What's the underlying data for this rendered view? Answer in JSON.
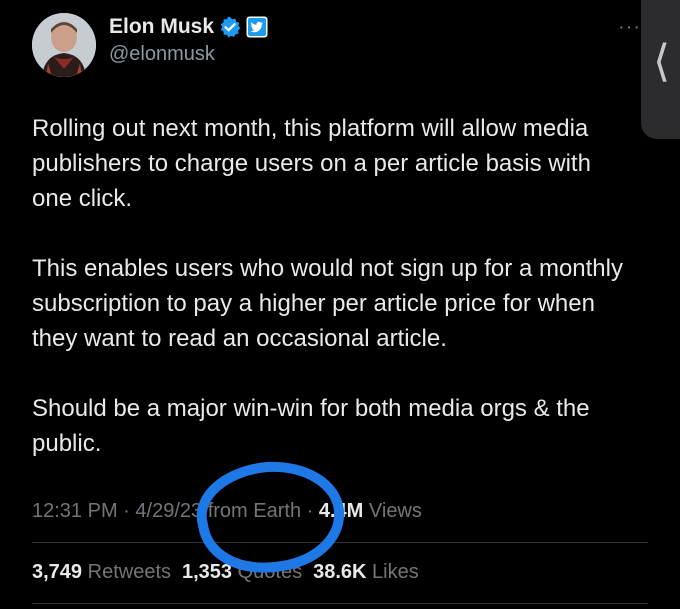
{
  "author": {
    "display_name": "Elon Musk",
    "handle": "@elonmusk",
    "verified_badge_icon": "verified-check-icon",
    "affiliate_badge_icon": "twitter-bird-icon"
  },
  "header": {
    "more_icon": "more-dots-icon"
  },
  "side_panel": {
    "chevron_icon": "chevron-left-icon"
  },
  "tweet": {
    "paragraphs": [
      "Rolling out next month, this platform will allow media publishers to charge users on a per article basis with one click.",
      "This enables users who would not sign up for a monthly subscription to pay a higher per article price for when they want to read an occasional article.",
      "Should be a major win-win for both media orgs & the public."
    ]
  },
  "meta": {
    "time": "12:31 PM",
    "separator": "·",
    "date": "4/29/23",
    "source": "from Earth",
    "views_count": "4.4M",
    "views_label": "Views"
  },
  "stats": {
    "retweets_count": "3,749",
    "retweets_label": "Retweets",
    "quotes_count": "1,353",
    "quotes_label": "Quotes",
    "likes_count": "38.6K",
    "likes_label": "Likes"
  },
  "colors": {
    "background": "#000000",
    "primary_text": "#e7e9ea",
    "secondary_text": "#71767b",
    "verified_blue": "#1d9bf0",
    "annotation_circle": "#1e78e6"
  }
}
